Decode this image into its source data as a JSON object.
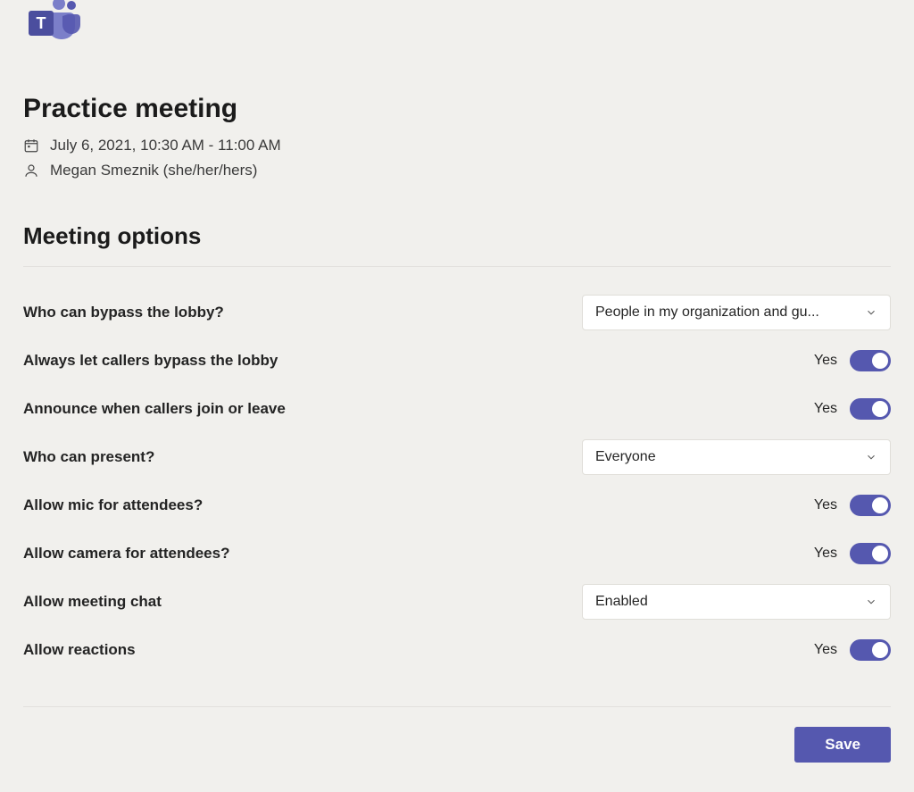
{
  "header": {
    "app_name": "Microsoft Teams",
    "meeting_title": "Practice meeting",
    "date_time": "July 6, 2021, 10:30 AM - 11:00 AM",
    "organizer": "Megan Smeznik (she/her/hers)"
  },
  "section_title": "Meeting options",
  "options": {
    "bypass_lobby": {
      "label": "Who can bypass the lobby?",
      "value": "People in my organization and gu..."
    },
    "callers_bypass": {
      "label": "Always let callers bypass the lobby",
      "state_text": "Yes",
      "on": true
    },
    "announce_callers": {
      "label": "Announce when callers join or leave",
      "state_text": "Yes",
      "on": true
    },
    "who_present": {
      "label": "Who can present?",
      "value": "Everyone"
    },
    "allow_mic": {
      "label": "Allow mic for attendees?",
      "state_text": "Yes",
      "on": true
    },
    "allow_camera": {
      "label": "Allow camera for attendees?",
      "state_text": "Yes",
      "on": true
    },
    "meeting_chat": {
      "label": "Allow meeting chat",
      "value": "Enabled"
    },
    "allow_reactions": {
      "label": "Allow reactions",
      "state_text": "Yes",
      "on": true
    }
  },
  "footer": {
    "save_label": "Save"
  },
  "colors": {
    "accent": "#5558af",
    "background": "#f1f0ed"
  }
}
